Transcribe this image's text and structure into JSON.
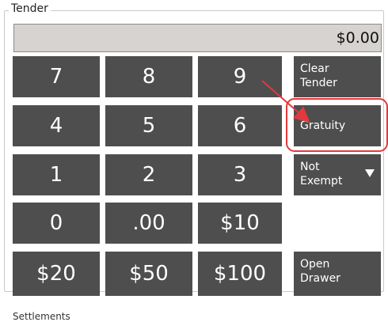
{
  "tender": {
    "group_title": "Tender",
    "amount": "$0.00"
  },
  "keypad": {
    "keys": [
      "7",
      "8",
      "9",
      "4",
      "5",
      "6",
      "1",
      "2",
      "3",
      "0",
      ".00",
      "$10",
      "$20",
      "$50",
      "$100"
    ]
  },
  "side_buttons": {
    "clear_tender": [
      "Clear",
      "Tender"
    ],
    "gratuity": "Gratuity",
    "not_exempt": [
      "Not",
      "Exempt"
    ],
    "open_drawer": [
      "Open",
      "Drawer"
    ]
  },
  "settlements": {
    "label": "Settlements"
  },
  "colors": {
    "button_bg": "#4e4e4e",
    "amount_bg": "#d6d3d0",
    "annotation_red": "#e03a3e"
  }
}
